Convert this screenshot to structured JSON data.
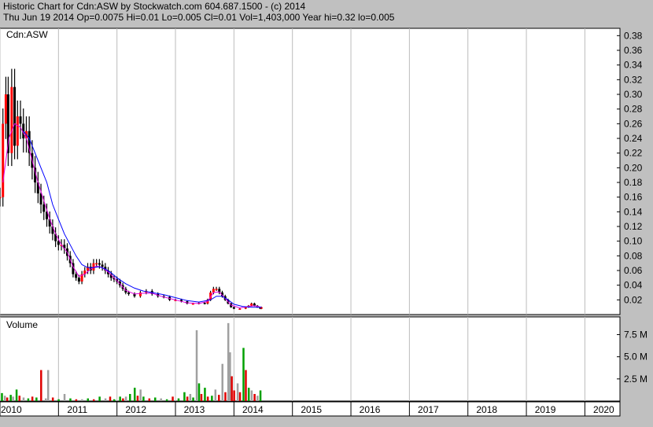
{
  "header": {
    "line1": "Historic Chart for Cdn:ASW by Stockwatch.com 604.687.1500 - (c) 2014",
    "line2": "Thu Jun 19 2014   Op=0.0075   Hi=0.01   Lo=0.005   Cl=0.01   Vol=1,403,000   Year hi=0.32   lo=0.005"
  },
  "colors": {
    "background": "#c0c0c0",
    "plot_bg": "#ffffff",
    "grid": "#bcbcbc",
    "candle_up": "#ff0000",
    "candle_down": "#000000",
    "ma_short": "#e000e0",
    "ma_long": "#0000ff",
    "volume_up": "#00a000",
    "volume_down": "#a0a0a0",
    "volume_red": "#e00000"
  },
  "chart_data": [
    {
      "type": "candlestick",
      "panel_label": "Cdn:ASW",
      "ylim": [
        0,
        0.39
      ],
      "y_ticks": [
        0.02,
        0.04,
        0.06,
        0.08,
        0.1,
        0.12,
        0.14,
        0.16,
        0.18,
        0.2,
        0.22,
        0.24,
        0.26,
        0.28,
        0.3,
        0.32,
        0.34,
        0.36,
        0.38
      ],
      "y_tick_labels": [
        "0.02",
        "0.04",
        "0.06",
        "0.08",
        "0.10",
        "0.12",
        "0.14",
        "0.16",
        "0.18",
        "0.20",
        "0.22",
        "0.24",
        "0.26",
        "0.28",
        "0.30",
        "0.32",
        "0.34",
        "0.36",
        "0.38"
      ],
      "xlim": [
        2010.0,
        2020.6
      ],
      "x_ticks": [
        2010,
        2011,
        2012,
        2013,
        2014,
        2015,
        2016,
        2017,
        2018,
        2019,
        2020
      ],
      "x_tick_labels": [
        "2010",
        "2011",
        "2012",
        "2013",
        "2014",
        "2015",
        "2016",
        "2017",
        "2018",
        "2019",
        "2020"
      ],
      "price_points": [
        [
          2010.0,
          0.16
        ],
        [
          2010.05,
          0.26
        ],
        [
          2010.1,
          0.3
        ],
        [
          2010.14,
          0.22
        ],
        [
          2010.2,
          0.31
        ],
        [
          2010.25,
          0.23
        ],
        [
          2010.3,
          0.27
        ],
        [
          2010.35,
          0.26
        ],
        [
          2010.4,
          0.24
        ],
        [
          2010.45,
          0.25
        ],
        [
          2010.5,
          0.22
        ],
        [
          2010.55,
          0.2
        ],
        [
          2010.6,
          0.18
        ],
        [
          2010.65,
          0.165
        ],
        [
          2010.7,
          0.15
        ],
        [
          2010.75,
          0.14
        ],
        [
          2010.8,
          0.13
        ],
        [
          2010.85,
          0.12
        ],
        [
          2010.9,
          0.11
        ],
        [
          2010.95,
          0.1
        ],
        [
          2011.0,
          0.095
        ],
        [
          2011.05,
          0.095
        ],
        [
          2011.1,
          0.09
        ],
        [
          2011.15,
          0.08
        ],
        [
          2011.2,
          0.07
        ],
        [
          2011.25,
          0.055
        ],
        [
          2011.3,
          0.05
        ],
        [
          2011.35,
          0.045
        ],
        [
          2011.4,
          0.055
        ],
        [
          2011.45,
          0.06
        ],
        [
          2011.5,
          0.065
        ],
        [
          2011.55,
          0.06
        ],
        [
          2011.6,
          0.07
        ],
        [
          2011.65,
          0.07
        ],
        [
          2011.7,
          0.068
        ],
        [
          2011.75,
          0.065
        ],
        [
          2011.8,
          0.06
        ],
        [
          2011.85,
          0.055
        ],
        [
          2011.9,
          0.05
        ],
        [
          2011.95,
          0.048
        ],
        [
          2012.0,
          0.045
        ],
        [
          2012.05,
          0.04
        ],
        [
          2012.1,
          0.035
        ],
        [
          2012.15,
          0.03
        ],
        [
          2012.2,
          0.028
        ],
        [
          2012.3,
          0.025
        ],
        [
          2012.4,
          0.03
        ],
        [
          2012.5,
          0.032
        ],
        [
          2012.6,
          0.028
        ],
        [
          2012.7,
          0.025
        ],
        [
          2012.8,
          0.024
        ],
        [
          2012.9,
          0.02
        ],
        [
          2013.0,
          0.02
        ],
        [
          2013.1,
          0.018
        ],
        [
          2013.2,
          0.015
        ],
        [
          2013.3,
          0.015
        ],
        [
          2013.4,
          0.016
        ],
        [
          2013.5,
          0.015
        ],
        [
          2013.55,
          0.02
        ],
        [
          2013.6,
          0.03
        ],
        [
          2013.65,
          0.035
        ],
        [
          2013.7,
          0.035
        ],
        [
          2013.75,
          0.03
        ],
        [
          2013.8,
          0.025
        ],
        [
          2013.85,
          0.02
        ],
        [
          2013.9,
          0.015
        ],
        [
          2013.95,
          0.01
        ],
        [
          2014.0,
          0.008
        ],
        [
          2014.1,
          0.008
        ],
        [
          2014.2,
          0.01
        ],
        [
          2014.25,
          0.012
        ],
        [
          2014.3,
          0.015
        ],
        [
          2014.35,
          0.012
        ],
        [
          2014.4,
          0.01
        ],
        [
          2014.45,
          0.008
        ],
        [
          2014.47,
          0.01
        ]
      ],
      "moving_average_short": [
        [
          2010.05,
          0.18
        ],
        [
          2010.15,
          0.24
        ],
        [
          2010.25,
          0.26
        ],
        [
          2010.35,
          0.255
        ],
        [
          2010.45,
          0.24
        ],
        [
          2010.55,
          0.21
        ],
        [
          2010.65,
          0.18
        ],
        [
          2010.75,
          0.155
        ],
        [
          2010.85,
          0.13
        ],
        [
          2010.95,
          0.11
        ],
        [
          2011.05,
          0.095
        ],
        [
          2011.15,
          0.085
        ],
        [
          2011.25,
          0.065
        ],
        [
          2011.35,
          0.052
        ],
        [
          2011.45,
          0.055
        ],
        [
          2011.55,
          0.062
        ],
        [
          2011.65,
          0.066
        ],
        [
          2011.75,
          0.064
        ],
        [
          2011.85,
          0.058
        ],
        [
          2011.95,
          0.05
        ],
        [
          2012.05,
          0.042
        ],
        [
          2012.15,
          0.033
        ],
        [
          2012.3,
          0.028
        ],
        [
          2012.45,
          0.029
        ],
        [
          2012.6,
          0.029
        ],
        [
          2012.75,
          0.025
        ],
        [
          2012.9,
          0.022
        ],
        [
          2013.05,
          0.019
        ],
        [
          2013.2,
          0.016
        ],
        [
          2013.4,
          0.015
        ],
        [
          2013.55,
          0.018
        ],
        [
          2013.65,
          0.03
        ],
        [
          2013.75,
          0.031
        ],
        [
          2013.85,
          0.022
        ],
        [
          2013.95,
          0.013
        ],
        [
          2014.1,
          0.009
        ],
        [
          2014.25,
          0.011
        ],
        [
          2014.35,
          0.012
        ],
        [
          2014.47,
          0.01
        ]
      ],
      "moving_average_long": [
        [
          2010.4,
          0.25
        ],
        [
          2010.5,
          0.24
        ],
        [
          2010.6,
          0.22
        ],
        [
          2010.7,
          0.2
        ],
        [
          2010.8,
          0.18
        ],
        [
          2010.9,
          0.15
        ],
        [
          2011.0,
          0.13
        ],
        [
          2011.1,
          0.11
        ],
        [
          2011.2,
          0.095
        ],
        [
          2011.3,
          0.08
        ],
        [
          2011.4,
          0.068
        ],
        [
          2011.5,
          0.064
        ],
        [
          2011.6,
          0.064
        ],
        [
          2011.7,
          0.065
        ],
        [
          2011.8,
          0.062
        ],
        [
          2011.9,
          0.057
        ],
        [
          2012.0,
          0.05
        ],
        [
          2012.15,
          0.042
        ],
        [
          2012.3,
          0.036
        ],
        [
          2012.45,
          0.032
        ],
        [
          2012.6,
          0.03
        ],
        [
          2012.8,
          0.027
        ],
        [
          2013.0,
          0.023
        ],
        [
          2013.2,
          0.019
        ],
        [
          2013.4,
          0.017
        ],
        [
          2013.6,
          0.02
        ],
        [
          2013.7,
          0.025
        ],
        [
          2013.8,
          0.025
        ],
        [
          2013.9,
          0.02
        ],
        [
          2014.0,
          0.014
        ],
        [
          2014.15,
          0.011
        ],
        [
          2014.3,
          0.01
        ],
        [
          2014.47,
          0.01
        ]
      ]
    },
    {
      "type": "bar",
      "panel_label": "Volume",
      "ylim": [
        0,
        9.5
      ],
      "y_ticks": [
        2.5,
        5.0,
        7.5
      ],
      "y_tick_labels": [
        "2.5 M",
        "5.0 M",
        "7.5 M"
      ],
      "units": "M",
      "volume_points": [
        [
          2010.03,
          0.9,
          "up"
        ],
        [
          2010.08,
          0.6,
          "down"
        ],
        [
          2010.12,
          0.4,
          "red"
        ],
        [
          2010.18,
          0.7,
          "up"
        ],
        [
          2010.22,
          0.5,
          "down"
        ],
        [
          2010.28,
          1.3,
          "up"
        ],
        [
          2010.33,
          0.6,
          "red"
        ],
        [
          2010.4,
          0.4,
          "down"
        ],
        [
          2010.48,
          0.3,
          "up"
        ],
        [
          2010.55,
          0.5,
          "red"
        ],
        [
          2010.62,
          0.4,
          "up"
        ],
        [
          2010.7,
          3.5,
          "red"
        ],
        [
          2010.78,
          0.3,
          "down"
        ],
        [
          2010.82,
          3.5,
          "down"
        ],
        [
          2010.9,
          0.4,
          "red"
        ],
        [
          2011.0,
          0.2,
          "up"
        ],
        [
          2011.1,
          0.8,
          "down"
        ],
        [
          2011.2,
          0.3,
          "up"
        ],
        [
          2011.3,
          0.2,
          "red"
        ],
        [
          2011.4,
          0.2,
          "down"
        ],
        [
          2011.5,
          0.3,
          "up"
        ],
        [
          2011.6,
          0.2,
          "red"
        ],
        [
          2011.7,
          0.5,
          "up"
        ],
        [
          2011.8,
          0.3,
          "down"
        ],
        [
          2011.88,
          0.5,
          "red"
        ],
        [
          2011.95,
          0.2,
          "up"
        ],
        [
          2012.05,
          0.5,
          "up"
        ],
        [
          2012.1,
          0.3,
          "red"
        ],
        [
          2012.15,
          0.5,
          "down"
        ],
        [
          2012.22,
          0.8,
          "up"
        ],
        [
          2012.3,
          1.5,
          "up"
        ],
        [
          2012.35,
          0.6,
          "red"
        ],
        [
          2012.4,
          1.3,
          "down"
        ],
        [
          2012.45,
          0.5,
          "up"
        ],
        [
          2012.55,
          0.3,
          "red"
        ],
        [
          2012.65,
          0.4,
          "up"
        ],
        [
          2012.75,
          0.3,
          "down"
        ],
        [
          2012.85,
          0.2,
          "up"
        ],
        [
          2012.95,
          0.5,
          "red"
        ],
        [
          2013.05,
          0.3,
          "up"
        ],
        [
          2013.15,
          1.0,
          "up"
        ],
        [
          2013.2,
          0.5,
          "red"
        ],
        [
          2013.25,
          0.8,
          "down"
        ],
        [
          2013.3,
          0.4,
          "up"
        ],
        [
          2013.36,
          8.0,
          "down"
        ],
        [
          2013.4,
          2.0,
          "up"
        ],
        [
          2013.44,
          0.8,
          "red"
        ],
        [
          2013.5,
          1.5,
          "up"
        ],
        [
          2013.55,
          0.5,
          "red"
        ],
        [
          2013.62,
          0.6,
          "up"
        ],
        [
          2013.68,
          1.3,
          "down"
        ],
        [
          2013.74,
          0.7,
          "red"
        ],
        [
          2013.8,
          4.2,
          "down"
        ],
        [
          2013.85,
          1.0,
          "red"
        ],
        [
          2013.9,
          8.8,
          "down"
        ],
        [
          2013.93,
          5.5,
          "down"
        ],
        [
          2013.96,
          2.8,
          "red"
        ],
        [
          2014.0,
          1.2,
          "red"
        ],
        [
          2014.06,
          2.0,
          "down"
        ],
        [
          2014.1,
          1.0,
          "red"
        ],
        [
          2014.16,
          6.0,
          "up"
        ],
        [
          2014.2,
          3.5,
          "red"
        ],
        [
          2014.25,
          1.5,
          "up"
        ],
        [
          2014.3,
          1.2,
          "down"
        ],
        [
          2014.35,
          0.8,
          "red"
        ],
        [
          2014.4,
          0.6,
          "down"
        ],
        [
          2014.45,
          1.2,
          "up"
        ]
      ]
    }
  ]
}
